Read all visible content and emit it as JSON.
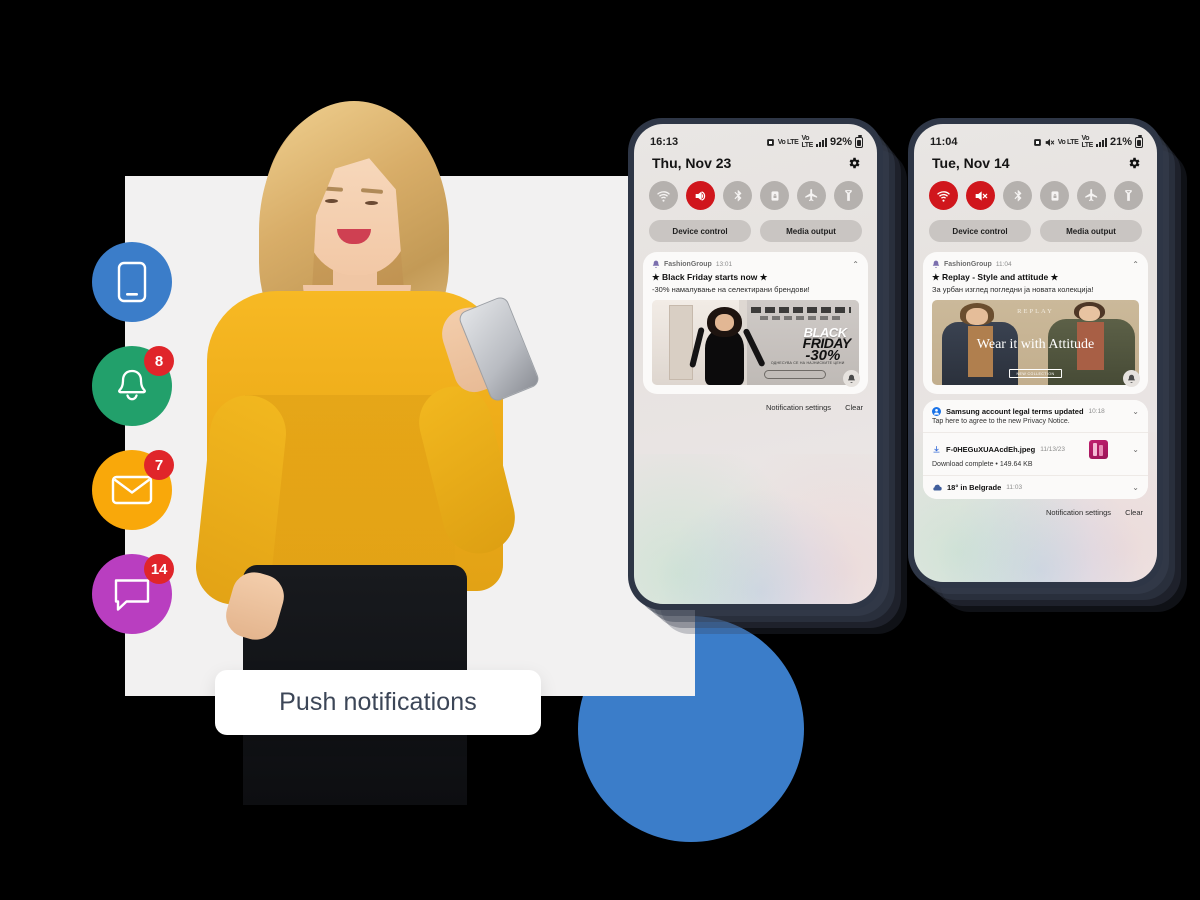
{
  "label": {
    "text": "Push notifications"
  },
  "colors": {
    "background": "#000000",
    "panel": "#f2f1f1",
    "accent_blue": "#3b7dc9",
    "badge_red": "#e0252a",
    "icon_phone_bg": "#3b7dc9",
    "icon_bell_bg": "#22a06b",
    "icon_mail_bg": "#f9a80a",
    "icon_chat_bg": "#b93ec0",
    "toggle_on": "#d0161c",
    "label_text": "#3c4657"
  },
  "rail": {
    "items": [
      {
        "name": "device-icon",
        "icon": "mobile-icon",
        "badge": null,
        "color": "#3b7dc9"
      },
      {
        "name": "notifications-icon",
        "icon": "bell-icon",
        "badge": "8",
        "color": "#22a06b"
      },
      {
        "name": "email-icon",
        "icon": "envelope-icon",
        "badge": "7",
        "color": "#f9a80a"
      },
      {
        "name": "messages-icon",
        "icon": "chat-bubble-icon",
        "badge": "14",
        "color": "#b93ec0"
      }
    ]
  },
  "phones": [
    {
      "id": "phone-left",
      "status": {
        "time": "16:13",
        "signal_label": "Vo LTE",
        "battery": "92%"
      },
      "date": "Thu, Nov 23",
      "settings_icon": "gear-icon",
      "toggles": [
        {
          "icon": "wifi-icon",
          "active": false
        },
        {
          "icon": "sound-icon",
          "active": true
        },
        {
          "icon": "bluetooth-icon",
          "active": false
        },
        {
          "icon": "auto-rotate-lock-icon",
          "active": false
        },
        {
          "icon": "airplane-mode-icon",
          "active": false
        },
        {
          "icon": "flashlight-icon",
          "active": false
        }
      ],
      "shortcuts": [
        "Device control",
        "Media output"
      ],
      "notification": {
        "app": "FashionGroup",
        "time": "13:01",
        "title": "★ Black Friday starts now ★",
        "body": "-30% намалување на селектирани брендови!",
        "banner": {
          "type": "black-friday",
          "headline_1": "BLACK",
          "headline_2": "FRIDAY",
          "headline_3": "-30%",
          "fineprint": "ОДНЕСУВА СЕ НА НАЈНИСКИТЕ ЦЕНИ",
          "cta": "КУПИ ВЕДНАШ"
        }
      },
      "footer": {
        "settings": "Notification settings",
        "clear": "Clear"
      }
    },
    {
      "id": "phone-right",
      "status": {
        "time": "11:04",
        "signal_label": "Vo LTE",
        "battery": "21%"
      },
      "date": "Tue, Nov 14",
      "settings_icon": "gear-icon",
      "toggles": [
        {
          "icon": "wifi-icon",
          "active": true
        },
        {
          "icon": "mute-icon",
          "active": true
        },
        {
          "icon": "bluetooth-icon",
          "active": false
        },
        {
          "icon": "auto-rotate-lock-icon",
          "active": false
        },
        {
          "icon": "airplane-mode-icon",
          "active": false
        },
        {
          "icon": "flashlight-icon",
          "active": false
        }
      ],
      "shortcuts": [
        "Device control",
        "Media output"
      ],
      "notification": {
        "app": "FashionGroup",
        "time": "11:04",
        "title": "★ Replay - Style and attitude ★",
        "body": "За урбан изглед погледни ја новата колекција!",
        "banner": {
          "type": "replay",
          "brand": "REPLAY",
          "headline": "Wear it with Attitude",
          "cta": "NEW COLLECTION"
        }
      },
      "more_notifications": [
        {
          "icon": "samsung-account-icon",
          "title": "Samsung account legal terms updated",
          "time": "10:18",
          "subtitle": "Tap here to agree to the new Privacy Notice.",
          "thumb": false
        },
        {
          "icon": "download-icon",
          "title": "F-0HEGuXUAAcdEh.jpeg",
          "time": "11/13/23",
          "subtitle": "Download complete • 149.64 KB",
          "thumb": true
        },
        {
          "icon": "weather-cloud-icon",
          "title": "18° in Belgrade",
          "time": "11:03",
          "subtitle": "",
          "thumb": false
        }
      ],
      "footer": {
        "settings": "Notification settings",
        "clear": "Clear"
      }
    }
  ]
}
